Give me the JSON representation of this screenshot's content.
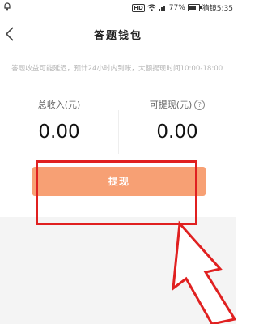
{
  "status_bar": {
    "left_icon": "notification-icon",
    "hd_badge": "HD",
    "battery_percent": "77%",
    "battery_level": 0.77,
    "right_text": "猜镜5:35"
  },
  "nav": {
    "back_icon": "chevron-left-icon",
    "title": "答题钱包"
  },
  "notice": "答题收益可能延迟，预计24小时内到账，大额提现时间10:00-18:00",
  "stats": {
    "total_income_label": "总收入(元)",
    "total_income_value": "0.00",
    "withdrawable_label": "可提现(元)",
    "withdrawable_value": "0.00",
    "help_icon": "question-circle-icon"
  },
  "withdraw_button_label": "提现",
  "colors": {
    "button": "#f7a074",
    "highlight": "#e02020",
    "notice_text": "#b5b5b5",
    "bottom_bg": "#f4f4f4"
  }
}
